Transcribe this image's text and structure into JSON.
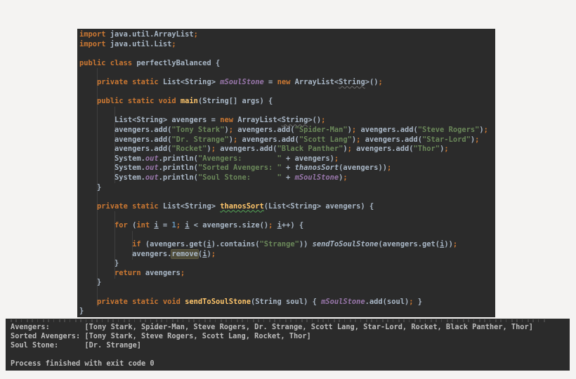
{
  "window": {
    "background": "#f4f3f2"
  },
  "editor": {
    "name": "code-editor",
    "background": "#2b2b2b",
    "language": "java",
    "class_name": "perfectlyBalanced",
    "lines": [
      [
        [
          "k",
          "import"
        ],
        [
          "d",
          " java.util.ArrayList"
        ],
        [
          "k",
          ";"
        ]
      ],
      [
        [
          "k",
          "import"
        ],
        [
          "d",
          " java.util.List"
        ],
        [
          "k",
          ";"
        ]
      ],
      [],
      [
        [
          "k",
          "public class"
        ],
        [
          "d",
          " perfectlyBalanced {"
        ]
      ],
      [],
      [
        [
          "d",
          "    "
        ],
        [
          "k",
          "private static"
        ],
        [
          "d",
          " List<String> "
        ],
        [
          "f",
          "mSoulStone"
        ],
        [
          "d",
          " = "
        ],
        [
          "k",
          "new"
        ],
        [
          "d",
          " ArrayList<"
        ],
        [
          "w",
          "String"
        ],
        [
          "d",
          ">()"
        ],
        [
          "k",
          ";"
        ]
      ],
      [],
      [
        [
          "d",
          "    "
        ],
        [
          "k",
          "public static void"
        ],
        [
          "d",
          " "
        ],
        [
          "m",
          "main"
        ],
        [
          "d",
          "(String[] args) {"
        ]
      ],
      [],
      [
        [
          "d",
          "        List<String> avengers = "
        ],
        [
          "k",
          "new"
        ],
        [
          "d",
          " ArrayList<"
        ],
        [
          "w",
          "String"
        ],
        [
          "d",
          ">()"
        ],
        [
          "k",
          ";"
        ]
      ],
      [
        [
          "d",
          "        avengers.add("
        ],
        [
          "s",
          "\"Tony Stark\""
        ],
        [
          "d",
          ")"
        ],
        [
          "k",
          ";"
        ],
        [
          "d",
          " avengers.add("
        ],
        [
          "s",
          "\"Spider-Man\""
        ],
        [
          "d",
          ")"
        ],
        [
          "k",
          ";"
        ],
        [
          "d",
          " avengers.add("
        ],
        [
          "s",
          "\"Steve Rogers\""
        ],
        [
          "d",
          ")"
        ],
        [
          "k",
          ";"
        ]
      ],
      [
        [
          "d",
          "        avengers.add("
        ],
        [
          "s",
          "\"Dr. Strange\""
        ],
        [
          "d",
          ")"
        ],
        [
          "k",
          ";"
        ],
        [
          "d",
          " avengers.add("
        ],
        [
          "s",
          "\"Scott Lang\""
        ],
        [
          "d",
          ")"
        ],
        [
          "k",
          ";"
        ],
        [
          "d",
          " avengers.add("
        ],
        [
          "s",
          "\"Star-Lord\""
        ],
        [
          "d",
          ")"
        ],
        [
          "k",
          ";"
        ]
      ],
      [
        [
          "d",
          "        avengers.add("
        ],
        [
          "s",
          "\"Rocket\""
        ],
        [
          "d",
          ")"
        ],
        [
          "k",
          ";"
        ],
        [
          "d",
          " avengers.add("
        ],
        [
          "s",
          "\"Black Panther\""
        ],
        [
          "d",
          ")"
        ],
        [
          "k",
          ";"
        ],
        [
          "d",
          " avengers.add("
        ],
        [
          "s",
          "\"Thor\""
        ],
        [
          "d",
          ")"
        ],
        [
          "k",
          ";"
        ]
      ],
      [
        [
          "d",
          "        System."
        ],
        [
          "f",
          "out"
        ],
        [
          "d",
          ".println("
        ],
        [
          "s",
          "\"Avengers:        \""
        ],
        [
          "d",
          " + avengers)"
        ],
        [
          "k",
          ";"
        ]
      ],
      [
        [
          "d",
          "        System."
        ],
        [
          "f",
          "out"
        ],
        [
          "d",
          ".println("
        ],
        [
          "s",
          "\"Sorted Avengers: \""
        ],
        [
          "d",
          " + "
        ],
        [
          "mi",
          "thanosSort"
        ],
        [
          "d",
          "(avengers))"
        ],
        [
          "k",
          ";"
        ]
      ],
      [
        [
          "d",
          "        System."
        ],
        [
          "f",
          "out"
        ],
        [
          "d",
          ".println("
        ],
        [
          "s",
          "\"Soul Stone:      \""
        ],
        [
          "d",
          " + "
        ],
        [
          "f",
          "mSoulStone"
        ],
        [
          "d",
          ")"
        ],
        [
          "k",
          ";"
        ]
      ],
      [
        [
          "d",
          "    }"
        ]
      ],
      [],
      [
        [
          "d",
          "    "
        ],
        [
          "k",
          "private static"
        ],
        [
          "d",
          " List<String> "
        ],
        [
          "mg",
          "thanosSort"
        ],
        [
          "d",
          "(List<String> avengers) {"
        ]
      ],
      [],
      [
        [
          "d",
          "        "
        ],
        [
          "k",
          "for"
        ],
        [
          "d",
          " ("
        ],
        [
          "k",
          "int"
        ],
        [
          "d",
          " "
        ],
        [
          "u",
          "i"
        ],
        [
          "d",
          " = "
        ],
        [
          "n",
          "1"
        ],
        [
          "k",
          ";"
        ],
        [
          "d",
          " "
        ],
        [
          "u",
          "i"
        ],
        [
          "d",
          " < avengers.size()"
        ],
        [
          "k",
          ";"
        ],
        [
          "d",
          " "
        ],
        [
          "u",
          "i"
        ],
        [
          "d",
          "++) {"
        ]
      ],
      [],
      [
        [
          "d",
          "            "
        ],
        [
          "k",
          "if"
        ],
        [
          "d",
          " (avengers.get("
        ],
        [
          "u",
          "i"
        ],
        [
          "d",
          ").contains("
        ],
        [
          "s",
          "\"Strange\""
        ],
        [
          "d",
          ")) "
        ],
        [
          "mi",
          "sendToSoulStone"
        ],
        [
          "d",
          "(avengers.get("
        ],
        [
          "u",
          "i"
        ],
        [
          "d",
          "))"
        ],
        [
          "k",
          ";"
        ]
      ],
      [
        [
          "d",
          "            avengers."
        ],
        [
          "hl",
          "remove"
        ],
        [
          "d",
          "("
        ],
        [
          "u",
          "i"
        ],
        [
          "d",
          ")"
        ],
        [
          "k",
          ";"
        ]
      ],
      [
        [
          "d",
          "        }"
        ]
      ],
      [
        [
          "d",
          "        "
        ],
        [
          "k",
          "return"
        ],
        [
          "d",
          " avengers"
        ],
        [
          "k",
          ";"
        ]
      ],
      [
        [
          "d",
          "    }"
        ]
      ],
      [],
      [
        [
          "d",
          "    "
        ],
        [
          "k",
          "private static void"
        ],
        [
          "d",
          " "
        ],
        [
          "m",
          "sendToSoulStone"
        ],
        [
          "d",
          "(String soul) { "
        ],
        [
          "f",
          "mSoulStone"
        ],
        [
          "d",
          ".add(soul)"
        ],
        [
          "k",
          ";"
        ],
        [
          "d",
          " }"
        ]
      ],
      [
        [
          "d",
          "}"
        ]
      ]
    ]
  },
  "console": {
    "name": "run-console",
    "background": "#2b2b2b",
    "text_color": "#bcbcbc",
    "lines": [
      "Avengers:        [Tony Stark, Spider-Man, Steve Rogers, Dr. Strange, Scott Lang, Star-Lord, Rocket, Black Panther, Thor]",
      "Sorted Avengers: [Tony Stark, Steve Rogers, Scott Lang, Rocket, Thor]",
      "Soul Stone:      [Dr. Strange]",
      "",
      "Process finished with exit code 0"
    ]
  },
  "syntax_palette": {
    "keyword": "#cc7832",
    "default_text": "#a9b7c6",
    "string": "#6a8759",
    "static_field": "#9876aa",
    "method_declaration": "#ffc66b",
    "number": "#6897bb",
    "warning_underline": "#707070",
    "method_warning_underline": "#54a857",
    "identifier_highlight_bg": "#4e4b38"
  }
}
